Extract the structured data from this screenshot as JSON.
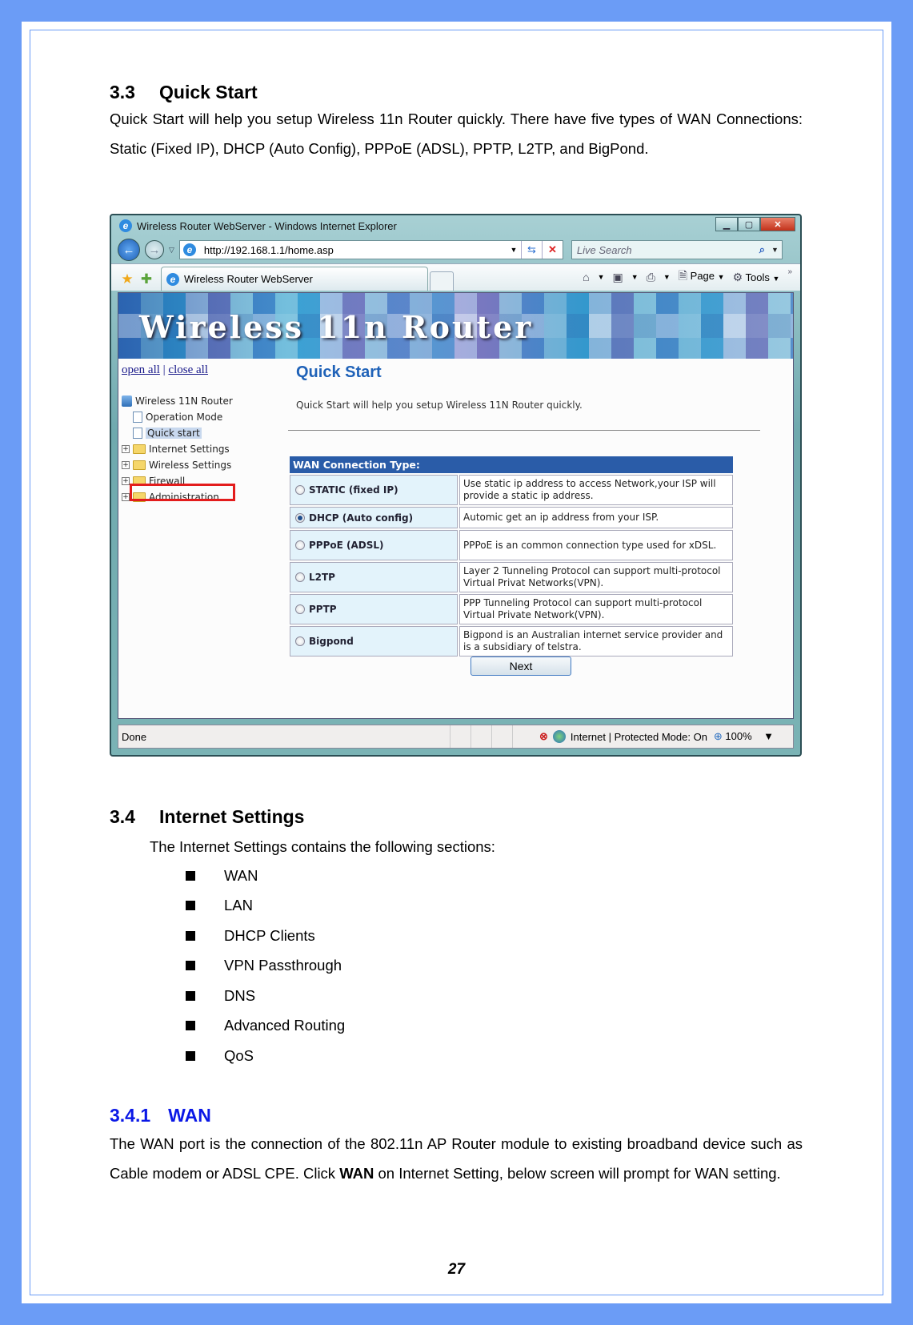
{
  "section_3_3": {
    "number": "3.3",
    "title": "Quick Start",
    "body": "Quick Start will help you setup Wireless 11n Router quickly. There have five types of WAN Connections: Static (Fixed IP), DHCP (Auto Config), PPPoE (ADSL), PPTP, L2TP, and BigPond."
  },
  "browser": {
    "window_title": "Wireless Router WebServer - Windows Internet Explorer",
    "url": "http://192.168.1.1/home.asp",
    "search_placeholder": "Live Search",
    "tab_title": "Wireless Router WebServer",
    "toolbar": {
      "page": "Page",
      "tools": "Tools"
    },
    "banner_title": "Wireless 11n Router",
    "tree": {
      "open_all": "open all",
      "separator": "|",
      "close_all": "close all",
      "root": "Wireless 11N Router",
      "items": [
        {
          "label": "Operation Mode",
          "type": "page"
        },
        {
          "label": "Quick start",
          "type": "page",
          "selected": true
        },
        {
          "label": "Internet Settings",
          "type": "folder"
        },
        {
          "label": "Wireless Settings",
          "type": "folder"
        },
        {
          "label": "Firewall",
          "type": "folder"
        },
        {
          "label": "Administration",
          "type": "folder"
        }
      ]
    },
    "page": {
      "title": "Quick Start",
      "description": "Quick Start will help you setup Wireless 11N Router quickly.",
      "table_header": "WAN Connection Type:",
      "options": [
        {
          "label": "STATIC (fixed IP)",
          "desc": "Use static ip address to access Network,your ISP will provide a static ip address.",
          "checked": false
        },
        {
          "label": "DHCP (Auto config)",
          "desc": "Automic get an ip address from your ISP.",
          "checked": true
        },
        {
          "label": "PPPoE (ADSL)",
          "desc": "PPPoE is an common connection type used for xDSL.",
          "checked": false
        },
        {
          "label": "L2TP",
          "desc": "Layer 2 Tunneling Protocol can support multi-protocol Virtual Privat Networks(VPN).",
          "checked": false
        },
        {
          "label": "PPTP",
          "desc": "PPP Tunneling Protocol can support multi-protocol Virtual Private Network(VPN).",
          "checked": false
        },
        {
          "label": "Bigpond",
          "desc": "Bigpond is an Australian internet service provider and is a subsidiary of telstra.",
          "checked": false
        }
      ],
      "next_button": "Next"
    },
    "status": {
      "text": "Done",
      "zone": "Internet | Protected Mode: On",
      "zoom": "100%"
    }
  },
  "section_3_4": {
    "number": "3.4",
    "title": "Internet Settings",
    "intro": "The Internet Settings contains the following sections:",
    "items": [
      "WAN",
      "LAN",
      "DHCP Clients",
      "VPN Passthrough",
      "DNS",
      "Advanced Routing",
      "QoS"
    ]
  },
  "section_3_4_1": {
    "number": "3.4.1",
    "title": "WAN",
    "body_before": "The WAN port is the connection of the 802.11n AP Router module to existing broadband device such as Cable modem or ADSL CPE. Click ",
    "body_bold": "WAN",
    "body_after": " on Internet Setting, below screen will prompt for WAN setting."
  },
  "page_number": "27",
  "colors": {
    "frame": "#6b9cf6",
    "subheading": "#0a18e6",
    "table_header": "#2a5ca8",
    "highlight_box": "#e31c1c"
  }
}
